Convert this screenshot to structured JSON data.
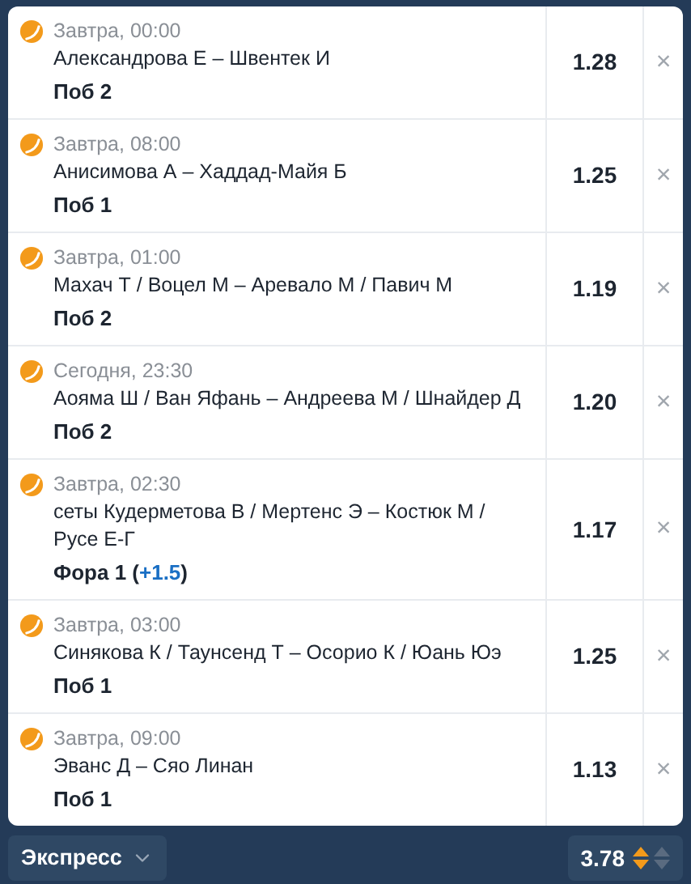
{
  "bets": [
    {
      "time": "Завтра, 00:00",
      "match": "Александрова Е – Швентек И",
      "bet": [
        {
          "text": "Поб 2",
          "kind": "plain"
        }
      ],
      "odds": "1.28",
      "remove": "×"
    },
    {
      "time": "Завтра, 08:00",
      "match": "Анисимова А – Хаддад-Майя Б",
      "bet": [
        {
          "text": "Поб 1",
          "kind": "plain"
        }
      ],
      "odds": "1.25",
      "remove": "×"
    },
    {
      "time": "Завтра, 01:00",
      "match": "Махач Т / Воцел М – Аревало М / Павич М",
      "bet": [
        {
          "text": "Поб 2",
          "kind": "plain"
        }
      ],
      "odds": "1.19",
      "remove": "×"
    },
    {
      "time": "Сегодня, 23:30",
      "match": "Аояма Ш / Ван Яфань – Андреева М / Шнайдер Д",
      "bet": [
        {
          "text": "Поб 2",
          "kind": "plain"
        }
      ],
      "odds": "1.20",
      "remove": "×"
    },
    {
      "time": "Завтра, 02:30",
      "match": "сеты Кудерметова В / Мертенс Э – Костюк М / Русе Е-Г",
      "bet": [
        {
          "text": "Фора 1 (",
          "kind": "plain"
        },
        {
          "text": "+1.5",
          "kind": "value"
        },
        {
          "text": ")",
          "kind": "plain"
        }
      ],
      "odds": "1.17",
      "remove": "×"
    },
    {
      "time": "Завтра, 03:00",
      "match": "Синякова К / Таунсенд Т – Осорио К / Юань Юэ",
      "bet": [
        {
          "text": "Поб 1",
          "kind": "plain"
        }
      ],
      "odds": "1.25",
      "remove": "×"
    },
    {
      "time": "Завтра, 09:00",
      "match": "Эванс Д – Сяо Линан",
      "bet": [
        {
          "text": "Поб 1",
          "kind": "plain"
        }
      ],
      "odds": "1.13",
      "remove": "×"
    }
  ],
  "footer": {
    "bet_type": "Экспресс",
    "total_odds": "3.78"
  }
}
